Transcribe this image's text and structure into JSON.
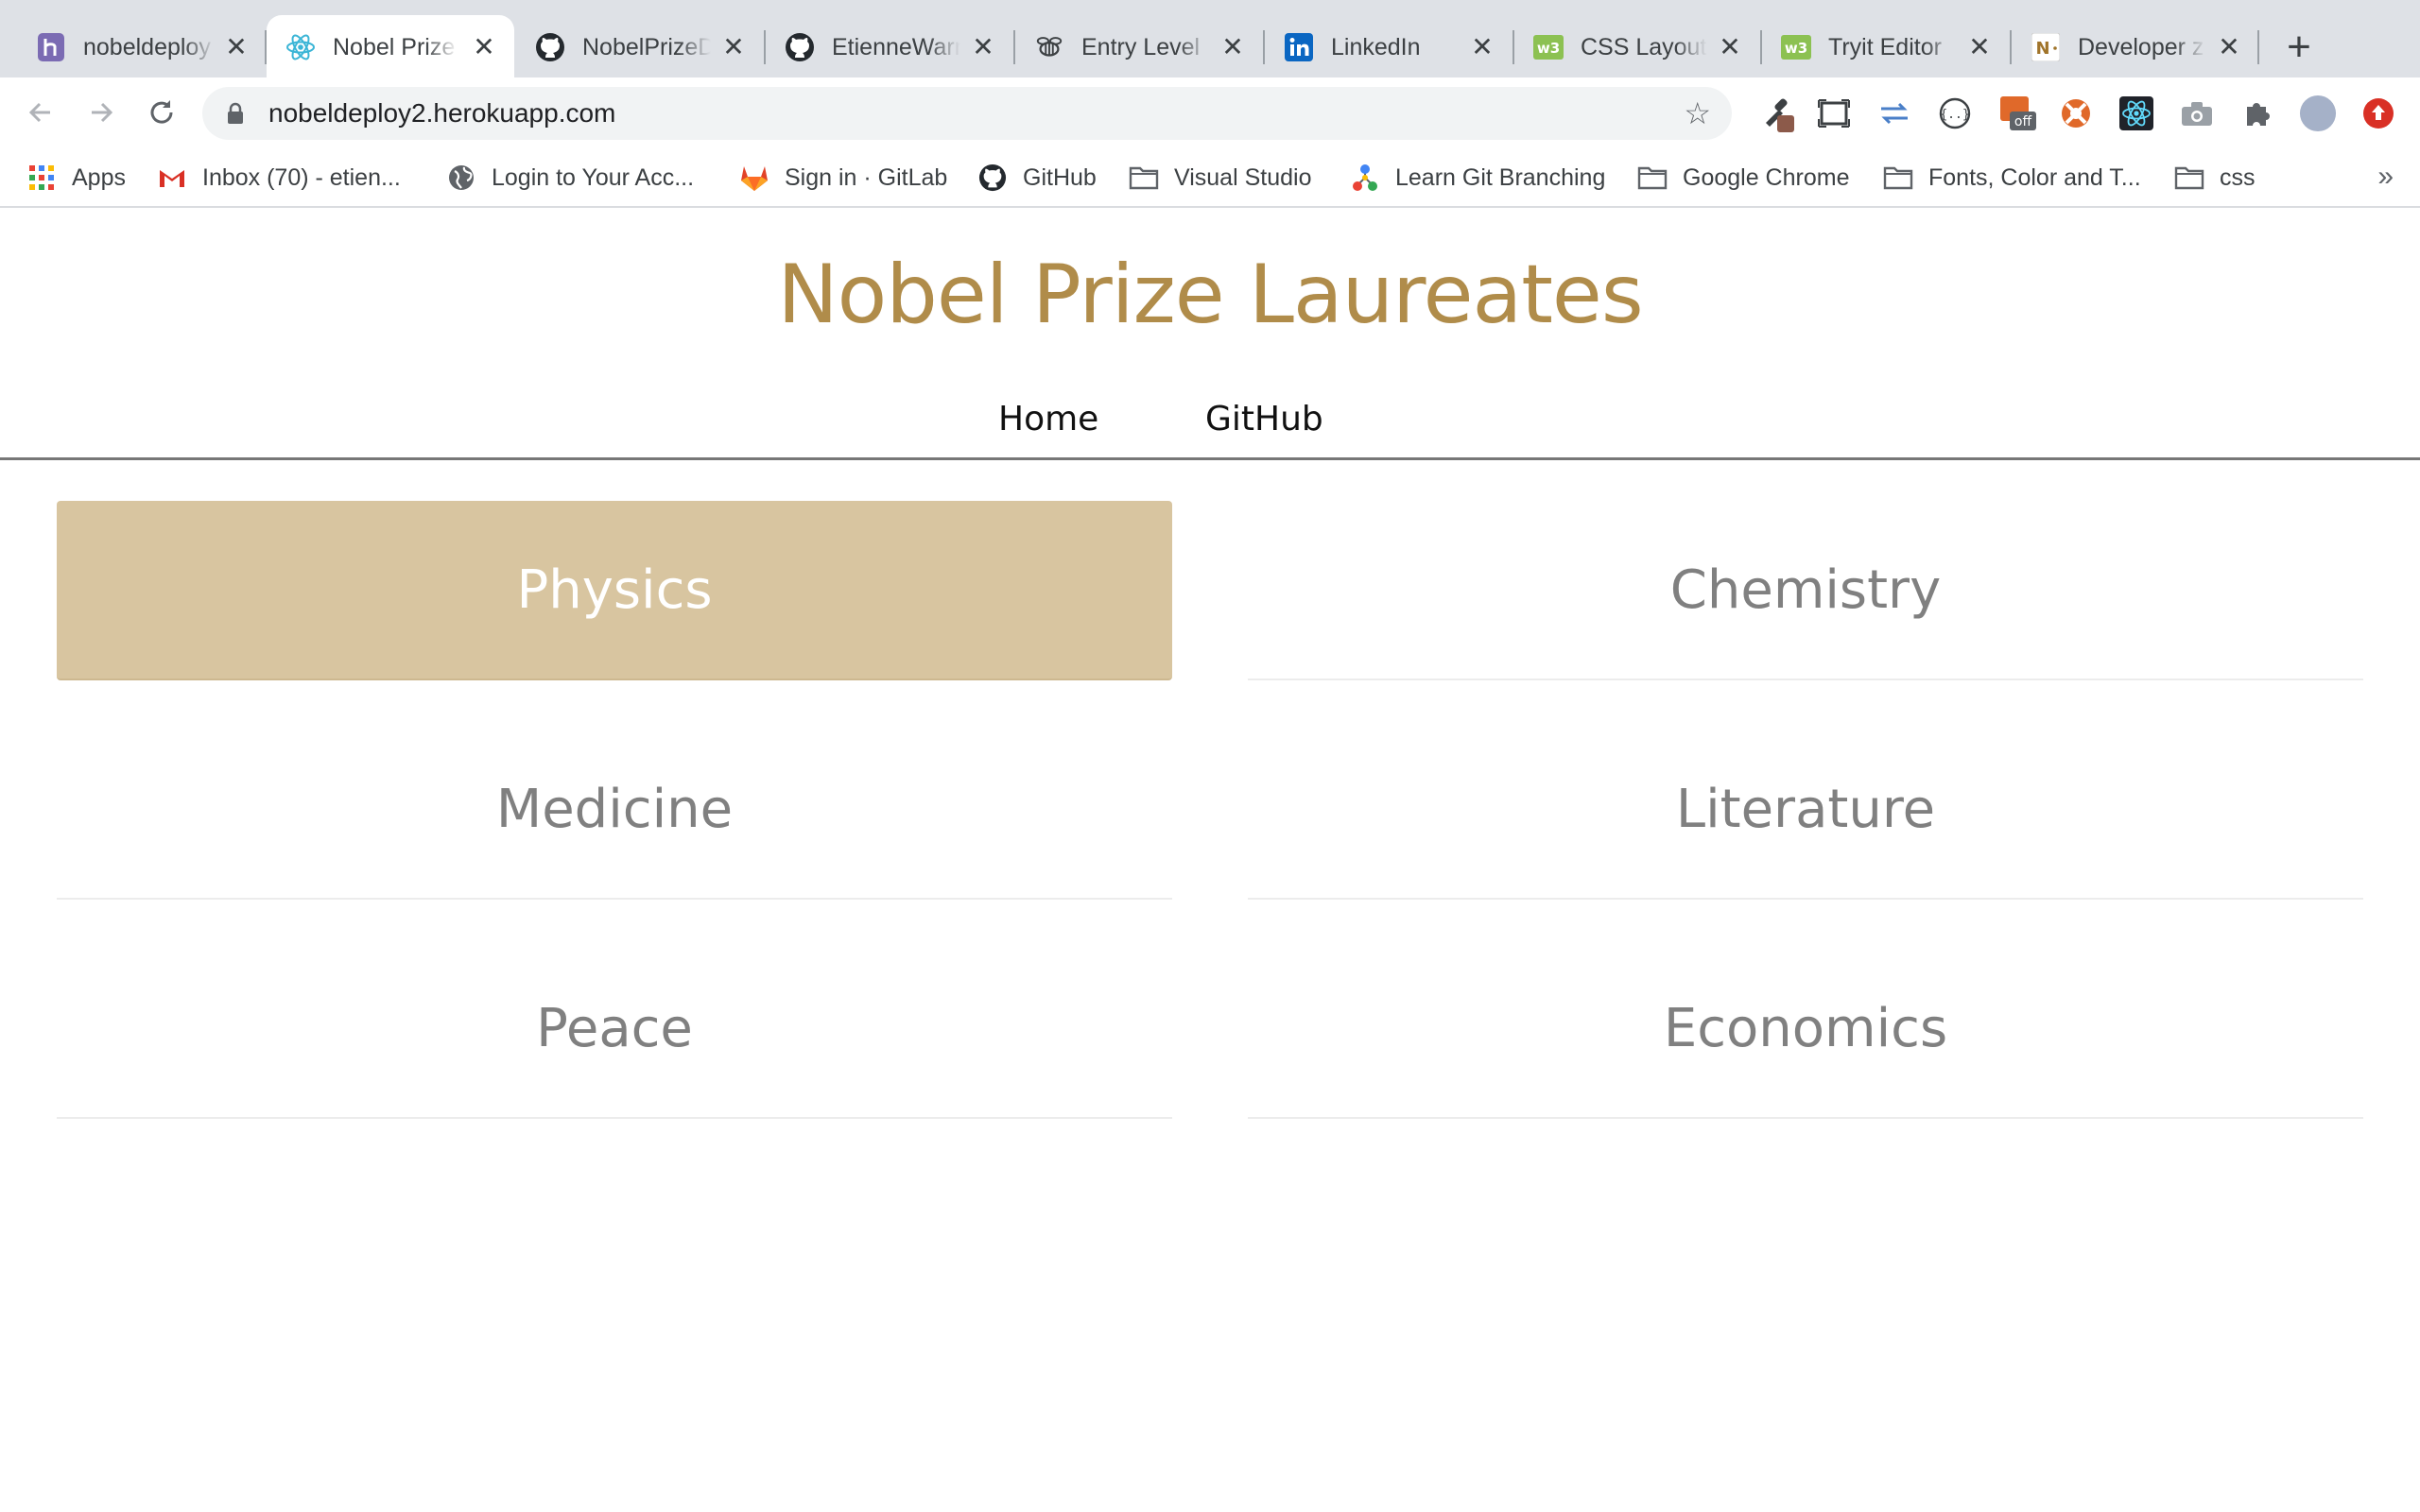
{
  "browser": {
    "tabs": [
      {
        "title": "nobeldeploy",
        "icon": "heroku-icon",
        "active": false
      },
      {
        "title": "Nobel Prize",
        "icon": "react-icon",
        "active": true
      },
      {
        "title": "NobelPrizeD",
        "icon": "github-icon",
        "active": false
      },
      {
        "title": "EtienneWarr",
        "icon": "github-icon",
        "active": false
      },
      {
        "title": "Entry Level",
        "icon": "bee-icon",
        "active": false
      },
      {
        "title": "LinkedIn",
        "icon": "linkedin-icon",
        "active": false
      },
      {
        "title": "CSS Layout",
        "icon": "w3schools-icon",
        "active": false
      },
      {
        "title": "Tryit Editor",
        "icon": "w3schools-icon",
        "active": false
      },
      {
        "title": "Developer z",
        "icon": "notion-icon",
        "active": false
      }
    ],
    "url": "nobeldeploy2.herokuapp.com",
    "bookmarks": [
      {
        "label": "Apps",
        "icon": "apps-grid-icon"
      },
      {
        "label": "Inbox (70) - etien...",
        "icon": "gmail-icon"
      },
      {
        "label": "Login to Your Acc...",
        "icon": "globe-icon"
      },
      {
        "label": "Sign in · GitLab",
        "icon": "gitlab-icon"
      },
      {
        "label": "GitHub",
        "icon": "github-icon"
      },
      {
        "label": "Visual Studio",
        "icon": "folder-icon"
      },
      {
        "label": "Learn Git Branching",
        "icon": "git-branch-icon"
      },
      {
        "label": "Google Chrome",
        "icon": "folder-icon"
      },
      {
        "label": "Fonts, Color and T...",
        "icon": "folder-icon"
      },
      {
        "label": "css",
        "icon": "folder-icon"
      }
    ],
    "colors": {
      "tabstrip": "#dee1e6",
      "omnibox": "#f1f3f4"
    }
  },
  "page": {
    "title": "Nobel Prize Laureates",
    "nav": {
      "home": "Home",
      "github": "GitHub"
    },
    "categories": [
      {
        "label": "Physics",
        "selected": true
      },
      {
        "label": "Chemistry",
        "selected": false
      },
      {
        "label": "Medicine",
        "selected": false
      },
      {
        "label": "Literature",
        "selected": false
      },
      {
        "label": "Peace",
        "selected": false
      },
      {
        "label": "Economics",
        "selected": false
      }
    ],
    "colors": {
      "title": "#b08c4a",
      "selected_tile": "#d8c5a0",
      "tile_text": "#808080"
    }
  }
}
